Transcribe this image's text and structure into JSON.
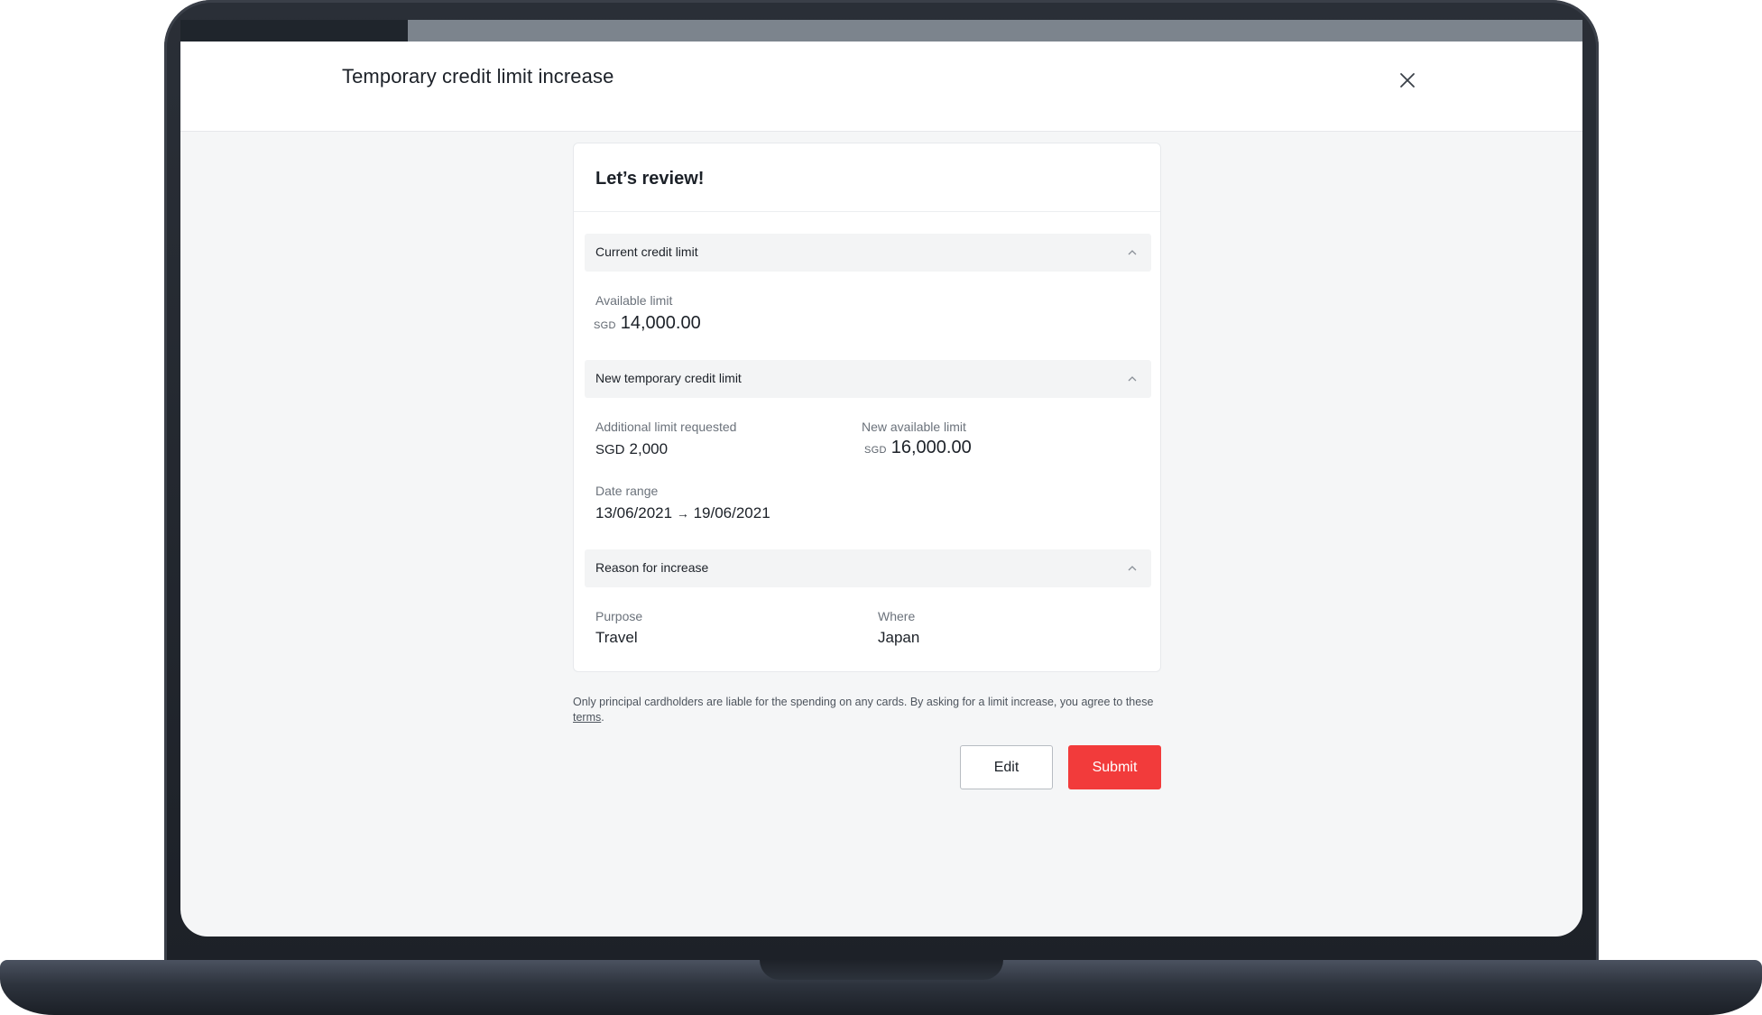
{
  "progress": {
    "fraction": 0.162
  },
  "header": {
    "title": "Temporary credit limit increase",
    "close_icon": "close-icon"
  },
  "review": {
    "title": "Let’s review!",
    "sections": [
      {
        "label": "Current credit limit",
        "icon": "chevron-up-icon"
      },
      {
        "label": "New temporary credit limit",
        "icon": "chevron-up-icon"
      },
      {
        "label": "Reason for increase",
        "icon": "chevron-up-icon"
      }
    ],
    "current_limit": {
      "available_label": "Available limit",
      "currency": "SGD",
      "amount": "14,000.00"
    },
    "new_limit": {
      "additional_label": "Additional limit requested",
      "additional_currency": "SGD",
      "additional_amount": "2,000",
      "new_available_label": "New available limit",
      "new_currency": "SGD",
      "new_amount": "16,000.00",
      "date_range_label": "Date range",
      "date_from": "13/06/2021",
      "date_arrow": "→",
      "date_to": "19/06/2021"
    },
    "reason": {
      "purpose_label": "Purpose",
      "purpose_value": "Travel",
      "where_label": "Where",
      "where_value": "Japan"
    }
  },
  "disclaimer": {
    "text": "Only principal cardholders are liable for the spending on any cards. By asking for a limit increase, you agree to these ",
    "link": "terms",
    "end": "."
  },
  "actions": {
    "edit_label": "Edit",
    "submit_label": "Submit"
  },
  "colors": {
    "accent": "#f23b3b",
    "progress_fill": "#1f252c",
    "progress_track": "#7c848d",
    "screen_bg": "#f5f6f7"
  }
}
